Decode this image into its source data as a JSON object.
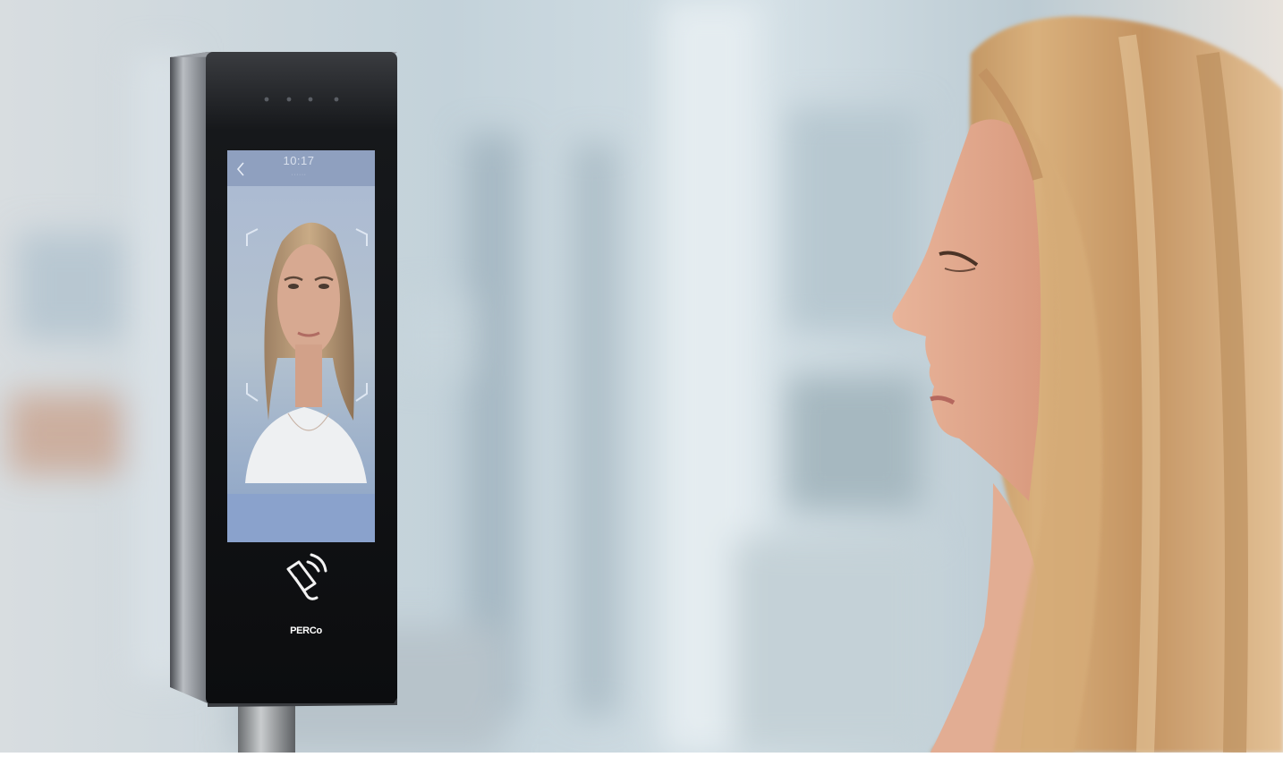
{
  "device": {
    "screen_time": "10:17",
    "screen_date": "······",
    "brand_logo": "PERCo"
  },
  "icons": {
    "back": "chevron-left-icon",
    "card_reader": "contactless-card-icon"
  },
  "colors": {
    "background": "#c9d6dc",
    "device_body": "#121417",
    "device_frame": "#7c8086",
    "screen": "#9fb4c9",
    "hair": "#caa16f",
    "skin": "#e7b399"
  }
}
